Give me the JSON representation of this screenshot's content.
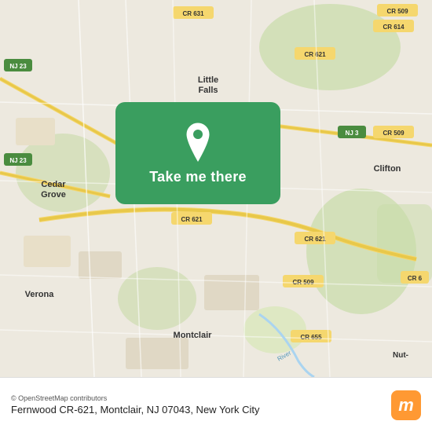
{
  "map": {
    "alt": "Map of Fernwood CR-621, Montclair area, New Jersey",
    "background_color": "#e8e0d8"
  },
  "overlay": {
    "button_label": "Take me there",
    "pin_icon": "location-pin-icon"
  },
  "bottom_bar": {
    "attribution": "© OpenStreetMap contributors",
    "location_text": "Fernwood CR-621, Montclair, NJ 07043, New York City",
    "moovit_label": "moovit"
  }
}
